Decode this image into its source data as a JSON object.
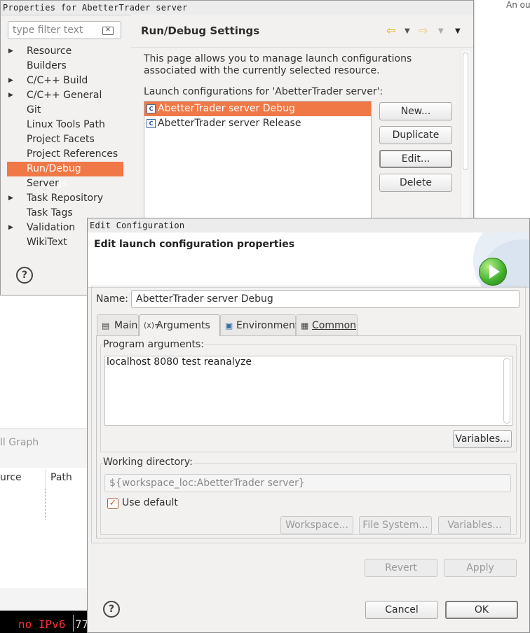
{
  "background": {
    "right_text": "An ou",
    "lower_tab": "ll Graph",
    "col_source": "urce",
    "col_path": "Path",
    "status_warning": "no IPv6",
    "status_next": "77"
  },
  "properties": {
    "title": "Properties for AbetterTrader server",
    "filter_placeholder": "type filter text",
    "tree": [
      {
        "label": "Resource",
        "expandable": true
      },
      {
        "label": "Builders",
        "expandable": false
      },
      {
        "label": "C/C++ Build",
        "expandable": true
      },
      {
        "label": "C/C++ General",
        "expandable": true
      },
      {
        "label": "Git",
        "expandable": false
      },
      {
        "label": "Linux Tools Path",
        "expandable": false
      },
      {
        "label": "Project Facets",
        "expandable": false
      },
      {
        "label": "Project References",
        "expandable": false
      },
      {
        "label": "Run/Debug Settings",
        "expandable": false,
        "selected": true
      },
      {
        "label": "Server",
        "expandable": false
      },
      {
        "label": "Task Repository",
        "expandable": true
      },
      {
        "label": "Task Tags",
        "expandable": false
      },
      {
        "label": "Validation",
        "expandable": true
      },
      {
        "label": "WikiText",
        "expandable": false
      }
    ],
    "page_title": "Run/Debug Settings",
    "description": "This page allows you to manage launch configurations associated with the currently selected resource.",
    "configs_label": "Launch configurations for 'AbetterTrader server':",
    "configs": [
      {
        "label": "AbetterTrader server Debug",
        "selected": true
      },
      {
        "label": "AbetterTrader server Release",
        "selected": false
      }
    ],
    "buttons": {
      "new": "New...",
      "duplicate": "Duplicate",
      "edit": "Edit...",
      "delete": "Delete"
    },
    "help": "?"
  },
  "edit": {
    "title": "Edit Configuration",
    "header": "Edit launch configuration properties",
    "name_label": "Name:",
    "name_value": "AbetterTrader server Debug",
    "tabs": [
      {
        "label": "Main",
        "active": false
      },
      {
        "label": "Arguments",
        "active": true
      },
      {
        "label": "Environment",
        "active": false
      },
      {
        "label": "Common",
        "active": false
      }
    ],
    "program_args_label": "Program arguments:",
    "program_args_value": "localhost 8080 test reanalyze",
    "variables_button": "Variables...",
    "working_dir_label": "Working directory:",
    "working_dir_value": "${workspace_loc:AbetterTrader server}",
    "use_default_label": "Use default",
    "use_default_checked": true,
    "workspace_button": "Workspace...",
    "filesystem_button": "File System...",
    "variables2_button": "Variables...",
    "revert_button": "Revert",
    "apply_button": "Apply",
    "cancel_button": "Cancel",
    "ok_button": "OK",
    "help": "?"
  },
  "colors": {
    "selection": "#f07746",
    "dialog_bg": "#f2f1f0"
  }
}
